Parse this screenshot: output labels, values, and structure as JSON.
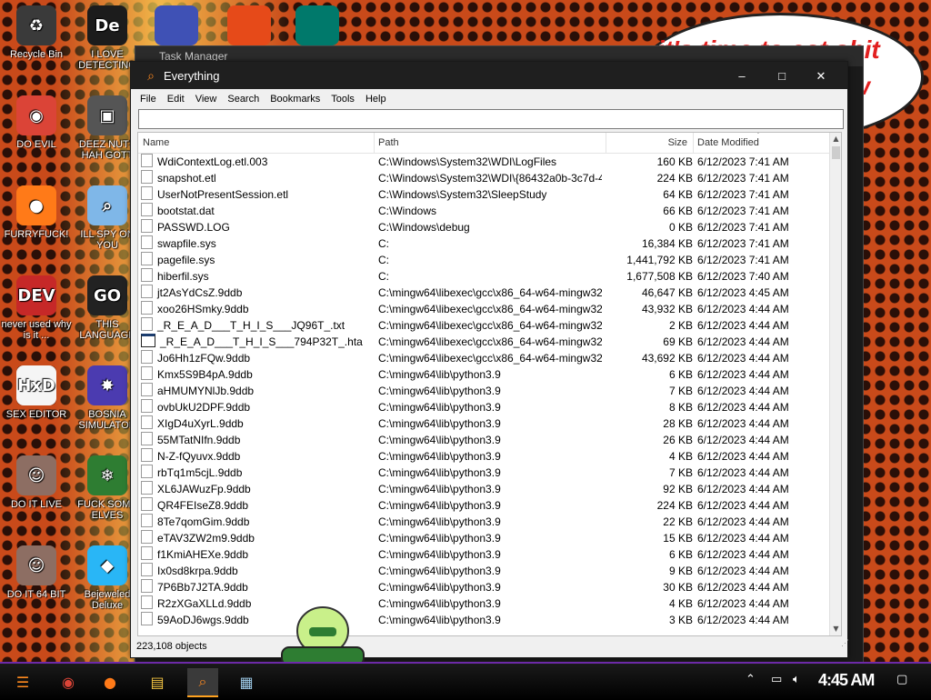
{
  "desktop": {
    "speech_line1": "it's time to eat shit",
    "speech_line2": "w",
    "icons": [
      {
        "label": "Recycle Bin",
        "icon": "recycle-bin-icon",
        "color": "#3a3a3a",
        "glyph": "♻"
      },
      {
        "label": "I LOVE DETECTING",
        "icon": "de-app-icon",
        "color": "#1c1c1c",
        "glyph": "De"
      },
      {
        "label": "DO EVIL",
        "icon": "chrome-icon",
        "color": "#db4437",
        "glyph": "◉"
      },
      {
        "label": "DEEZ NUTS HAH GOTT",
        "icon": "windows-stack-icon",
        "color": "#555555",
        "glyph": "▣"
      },
      {
        "label": "FURRYFUCK!",
        "icon": "firefox-icon",
        "color": "#ff7a18",
        "glyph": "●"
      },
      {
        "label": "ILL SPY ON YOU",
        "icon": "magnifier-icon",
        "color": "#7fb7e8",
        "glyph": "⌕"
      },
      {
        "label": "never used why is it ...",
        "icon": "dev-cpp-icon",
        "color": "#c62828",
        "glyph": "DEV"
      },
      {
        "label": "THIS LANGUAGE",
        "icon": "go-lang-icon",
        "color": "#222222",
        "glyph": "GO"
      },
      {
        "label": "SEX EDITOR",
        "icon": "hxd-icon",
        "color": "#f5f5f5",
        "glyph": "HxD"
      },
      {
        "label": "BOSNIA SIMULATOR",
        "icon": "mine-icon",
        "color": "#4b3bb0",
        "glyph": "✸"
      },
      {
        "label": "DO IT LIVE",
        "icon": "portrait-icon",
        "color": "#8d6e63",
        "glyph": "☺"
      },
      {
        "label": "FUCK SOME ELVES",
        "icon": "elf-game-icon",
        "color": "#2e7d32",
        "glyph": "❄"
      },
      {
        "label": "DO IT 64 BIT",
        "icon": "portrait-64-icon",
        "color": "#8d6e63",
        "glyph": "☺"
      },
      {
        "label": "Bejeweled Deluxe",
        "icon": "diamond-icon",
        "color": "#29b6f6",
        "glyph": "◆"
      }
    ]
  },
  "task_manager": {
    "title": "Task Manager"
  },
  "everything": {
    "title": "Everything",
    "menu": [
      "File",
      "Edit",
      "View",
      "Search",
      "Bookmarks",
      "Tools",
      "Help"
    ],
    "search_value": "",
    "columns": {
      "name": "Name",
      "path": "Path",
      "size": "Size",
      "date": "Date Modified"
    },
    "rows": [
      {
        "name": "WdiContextLog.etl.003",
        "path": "C:\\Windows\\System32\\WDI\\LogFiles",
        "size": "160 KB",
        "date": "6/12/2023 7:41 AM",
        "type": "file"
      },
      {
        "name": "snapshot.etl",
        "path": "C:\\Windows\\System32\\WDI\\{86432a0b-3c7d-4d...",
        "size": "224 KB",
        "date": "6/12/2023 7:41 AM",
        "type": "file"
      },
      {
        "name": "UserNotPresentSession.etl",
        "path": "C:\\Windows\\System32\\SleepStudy",
        "size": "64 KB",
        "date": "6/12/2023 7:41 AM",
        "type": "file"
      },
      {
        "name": "bootstat.dat",
        "path": "C:\\Windows",
        "size": "66 KB",
        "date": "6/12/2023 7:41 AM",
        "type": "file"
      },
      {
        "name": "PASSWD.LOG",
        "path": "C:\\Windows\\debug",
        "size": "0 KB",
        "date": "6/12/2023 7:41 AM",
        "type": "file"
      },
      {
        "name": "swapfile.sys",
        "path": "C:",
        "size": "16,384 KB",
        "date": "6/12/2023 7:41 AM",
        "type": "sys"
      },
      {
        "name": "pagefile.sys",
        "path": "C:",
        "size": "1,441,792 KB",
        "date": "6/12/2023 7:41 AM",
        "type": "sys"
      },
      {
        "name": "hiberfil.sys",
        "path": "C:",
        "size": "1,677,508 KB",
        "date": "6/12/2023 7:40 AM",
        "type": "sys"
      },
      {
        "name": "jt2AsYdCsZ.9ddb",
        "path": "C:\\mingw64\\libexec\\gcc\\x86_64-w64-mingw32\\...",
        "size": "46,647 KB",
        "date": "6/12/2023 4:45 AM",
        "type": "file"
      },
      {
        "name": "xoo26HSmky.9ddb",
        "path": "C:\\mingw64\\libexec\\gcc\\x86_64-w64-mingw32\\...",
        "size": "43,932 KB",
        "date": "6/12/2023 4:44 AM",
        "type": "file"
      },
      {
        "name": "_R_E_A_D___T_H_I_S___JQ96T_.txt",
        "path": "C:\\mingw64\\libexec\\gcc\\x86_64-w64-mingw32\\...",
        "size": "2 KB",
        "date": "6/12/2023 4:44 AM",
        "type": "file"
      },
      {
        "name": "_R_E_A_D___T_H_I_S___794P32T_.hta",
        "path": "C:\\mingw64\\libexec\\gcc\\x86_64-w64-mingw32\\...",
        "size": "69 KB",
        "date": "6/12/2023 4:44 AM",
        "type": "hta"
      },
      {
        "name": "Jo6Hh1zFQw.9ddb",
        "path": "C:\\mingw64\\libexec\\gcc\\x86_64-w64-mingw32\\...",
        "size": "43,692 KB",
        "date": "6/12/2023 4:44 AM",
        "type": "file"
      },
      {
        "name": "Kmx5S9B4pA.9ddb",
        "path": "C:\\mingw64\\lib\\python3.9",
        "size": "6 KB",
        "date": "6/12/2023 4:44 AM",
        "type": "file"
      },
      {
        "name": "aHMUMYNlJb.9ddb",
        "path": "C:\\mingw64\\lib\\python3.9",
        "size": "7 KB",
        "date": "6/12/2023 4:44 AM",
        "type": "file"
      },
      {
        "name": "ovbUkU2DPF.9ddb",
        "path": "C:\\mingw64\\lib\\python3.9",
        "size": "8 KB",
        "date": "6/12/2023 4:44 AM",
        "type": "file"
      },
      {
        "name": "XIgD4uXyrL.9ddb",
        "path": "C:\\mingw64\\lib\\python3.9",
        "size": "28 KB",
        "date": "6/12/2023 4:44 AM",
        "type": "file"
      },
      {
        "name": "55MTatNIfn.9ddb",
        "path": "C:\\mingw64\\lib\\python3.9",
        "size": "26 KB",
        "date": "6/12/2023 4:44 AM",
        "type": "file"
      },
      {
        "name": "N-Z-fQyuvx.9ddb",
        "path": "C:\\mingw64\\lib\\python3.9",
        "size": "4 KB",
        "date": "6/12/2023 4:44 AM",
        "type": "file"
      },
      {
        "name": "rbTq1m5cjL.9ddb",
        "path": "C:\\mingw64\\lib\\python3.9",
        "size": "7 KB",
        "date": "6/12/2023 4:44 AM",
        "type": "file"
      },
      {
        "name": "XL6JAWuzFp.9ddb",
        "path": "C:\\mingw64\\lib\\python3.9",
        "size": "92 KB",
        "date": "6/12/2023 4:44 AM",
        "type": "file"
      },
      {
        "name": "QR4FEIseZ8.9ddb",
        "path": "C:\\mingw64\\lib\\python3.9",
        "size": "224 KB",
        "date": "6/12/2023 4:44 AM",
        "type": "file"
      },
      {
        "name": "8Te7qomGim.9ddb",
        "path": "C:\\mingw64\\lib\\python3.9",
        "size": "22 KB",
        "date": "6/12/2023 4:44 AM",
        "type": "file"
      },
      {
        "name": "eTAV3ZW2m9.9ddb",
        "path": "C:\\mingw64\\lib\\python3.9",
        "size": "15 KB",
        "date": "6/12/2023 4:44 AM",
        "type": "file"
      },
      {
        "name": "f1KmiAHEXe.9ddb",
        "path": "C:\\mingw64\\lib\\python3.9",
        "size": "6 KB",
        "date": "6/12/2023 4:44 AM",
        "type": "file"
      },
      {
        "name": "Ix0sd8krpa.9ddb",
        "path": "C:\\mingw64\\lib\\python3.9",
        "size": "9 KB",
        "date": "6/12/2023 4:44 AM",
        "type": "file"
      },
      {
        "name": "7P6Bb7J2TA.9ddb",
        "path": "C:\\mingw64\\lib\\python3.9",
        "size": "30 KB",
        "date": "6/12/2023 4:44 AM",
        "type": "file"
      },
      {
        "name": "R2zXGaXLLd.9ddb",
        "path": "C:\\mingw64\\lib\\python3.9",
        "size": "4 KB",
        "date": "6/12/2023 4:44 AM",
        "type": "file"
      },
      {
        "name": "59AoDJ6wgs.9ddb",
        "path": "C:\\mingw64\\lib\\python3.9",
        "size": "3 KB",
        "date": "6/12/2023 4:44 AM",
        "type": "file"
      }
    ],
    "status": "223,108 objects"
  },
  "taskbar": {
    "clock": "4:45 AM",
    "items": [
      {
        "name": "start-button",
        "glyph": "☰",
        "color": "#ff8a1f"
      },
      {
        "name": "chrome-taskbar-icon",
        "glyph": "◉",
        "color": "#db4437"
      },
      {
        "name": "firefox-taskbar-icon",
        "glyph": "●",
        "color": "#ff7a18"
      },
      {
        "name": "file-explorer-taskbar-icon",
        "glyph": "▤",
        "color": "#f5c542"
      },
      {
        "name": "everything-taskbar-icon",
        "glyph": "⌕",
        "color": "#ff8a1f"
      },
      {
        "name": "task-manager-taskbar-icon",
        "glyph": "▦",
        "color": "#9ecbe8"
      }
    ]
  }
}
